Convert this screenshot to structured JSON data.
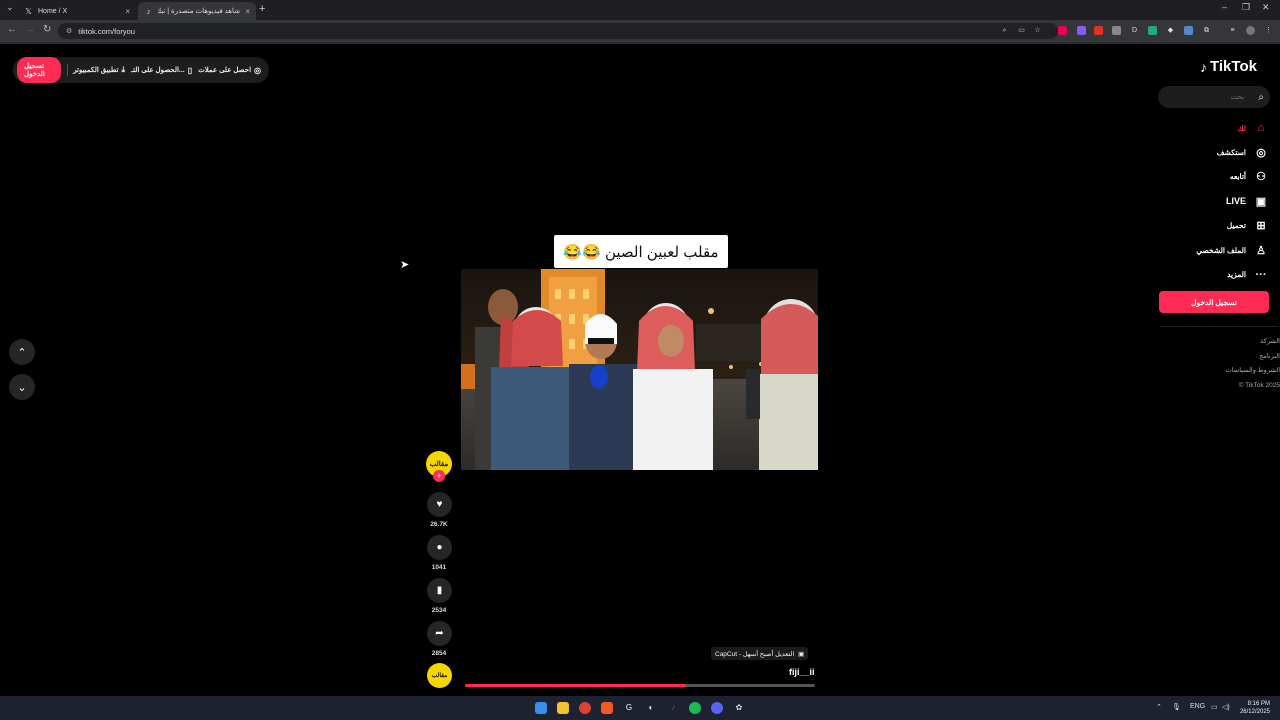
{
  "browser": {
    "tabs": [
      {
        "title": "Home / X",
        "icon": "x-logo-icon"
      },
      {
        "title": "شاهد فيديوهات متصدرة | ﺗﻴﻚ",
        "icon": "tiktok-logo-icon"
      }
    ],
    "url": "tiktok.com/foryou"
  },
  "topbar": {
    "login_label": "تسجيل الدخول",
    "desktop_app_label": "تطبيق الكمبيوتر",
    "get_app_label": "الحصول على التـ...",
    "coins_label": "احصل على عملات"
  },
  "sidebar": {
    "logo_text": "TikTok",
    "search_placeholder": "بحث",
    "items": [
      {
        "label": "لك",
        "icon": "home-icon",
        "active": true
      },
      {
        "label": "استكشف",
        "icon": "compass-icon"
      },
      {
        "label": "أتابعه",
        "icon": "user-follow-icon"
      },
      {
        "label": "LIVE",
        "icon": "live-icon"
      },
      {
        "label": "تحميل",
        "icon": "upload-plus-icon"
      },
      {
        "label": "الملف الشخصي",
        "icon": "profile-icon"
      },
      {
        "label": "المزيد",
        "icon": "more-dots-icon"
      }
    ],
    "login_button": "تسجيل الدخول",
    "footer": [
      "الشركة",
      "البرنامج",
      "الشروط والسياسات",
      "© TikTok 2025"
    ]
  },
  "video": {
    "caption": "مقلب لعبين الصين 😂😂",
    "author": "fiji__ii",
    "effect_tag": "CapCut - التعديل أصبح أسهل",
    "progress_fraction": 0.63,
    "avatar_text": "مقالب",
    "likes": "26.7K",
    "comments": "1041",
    "saves": "2534",
    "shares": "2854"
  },
  "taskbar": {
    "lang": "ENG",
    "time": "8:16 PM",
    "date": "26/12/2025"
  },
  "colors": {
    "accent": "#fe2c55",
    "avatar_yellow": "#f5d600"
  }
}
